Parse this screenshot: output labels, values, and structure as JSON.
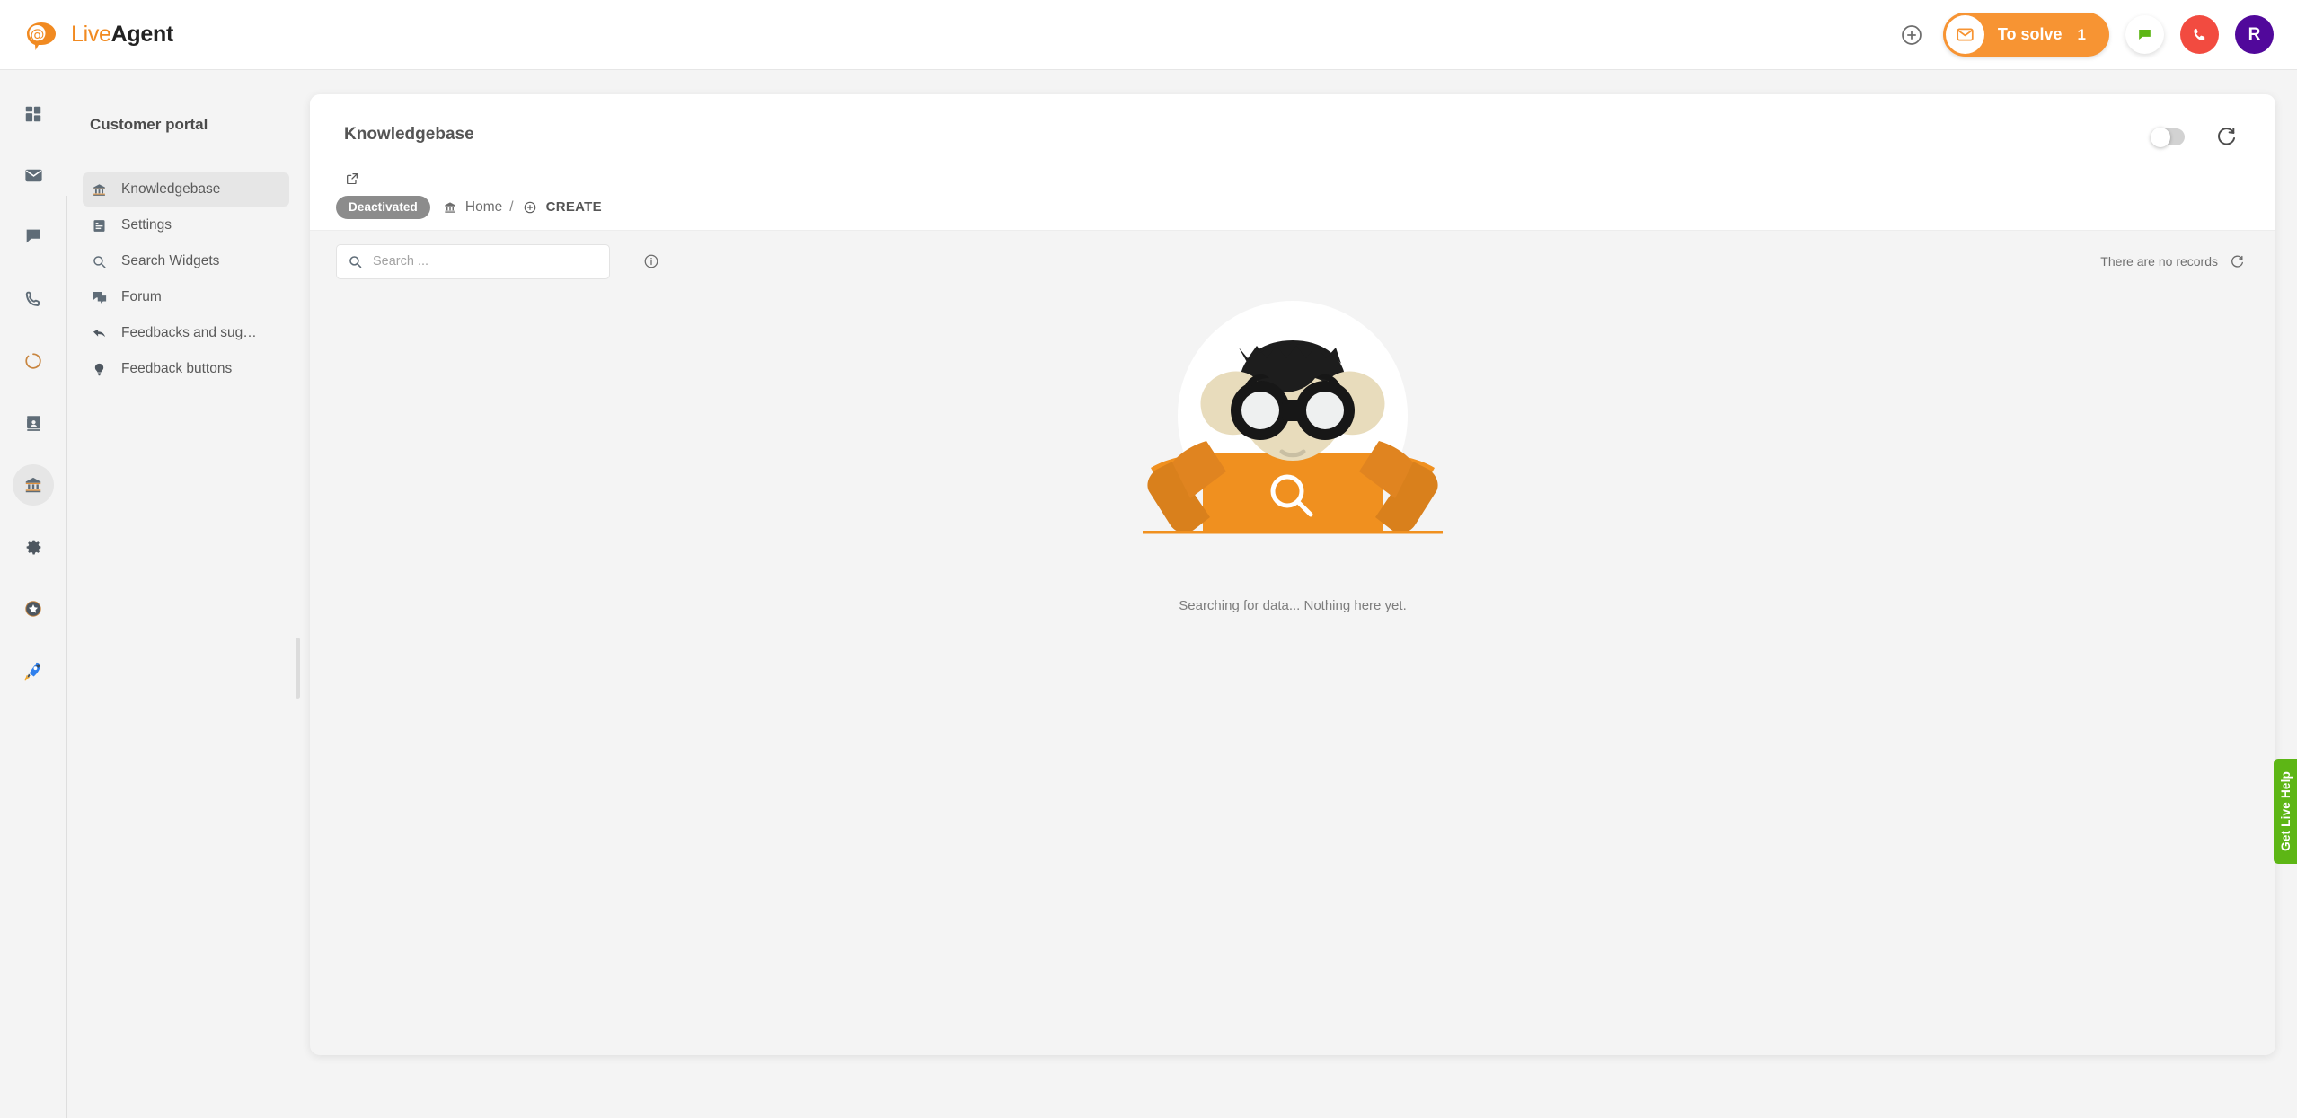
{
  "app": {
    "brand_live": "Live",
    "brand_agent": "Agent",
    "brand_logo_icon": "at-speech-bubble-logo"
  },
  "topbar": {
    "add_icon": "plus-circle-icon",
    "to_solve": {
      "icon": "envelope-icon",
      "label": "To solve",
      "count": "1"
    },
    "chat_icon": "chat-bubble-icon",
    "call_icon": "phone-icon",
    "avatar_initial": "R",
    "colors": {
      "accent_orange": "#f79433",
      "call_red": "#f24b40",
      "avatar_purple": "#51089b",
      "chat_green": "#5db615"
    }
  },
  "rail": {
    "items": [
      {
        "icon": "dashboard-grid-icon",
        "active": false
      },
      {
        "icon": "mail-icon",
        "active": false
      },
      {
        "icon": "chat-icon",
        "active": false
      },
      {
        "icon": "phone-icon",
        "active": false
      },
      {
        "icon": "circle-progress-icon",
        "active": false
      },
      {
        "icon": "contacts-card-icon",
        "active": false
      },
      {
        "icon": "knowledgebase-bank-icon",
        "active": true
      },
      {
        "icon": "gear-settings-icon",
        "active": false
      },
      {
        "icon": "star-badge-icon",
        "active": false
      },
      {
        "icon": "rocket-icon",
        "active": false
      }
    ]
  },
  "sidebar": {
    "title": "Customer portal",
    "items": [
      {
        "label": "Knowledgebase",
        "icon": "bank-icon",
        "active": true
      },
      {
        "label": "Settings",
        "icon": "list-settings-icon",
        "active": false
      },
      {
        "label": "Search Widgets",
        "icon": "search-icon",
        "active": false
      },
      {
        "label": "Forum",
        "icon": "forum-icon",
        "active": false
      },
      {
        "label": "Feedbacks and sug…",
        "icon": "reply-arrow-icon",
        "active": false
      },
      {
        "label": "Feedback buttons",
        "icon": "lightbulb-icon",
        "active": false
      }
    ]
  },
  "card": {
    "title": "Knowledgebase",
    "external_link_icon": "external-link-icon",
    "toggle": {
      "state": "off",
      "name": "activation-toggle"
    },
    "refresh_icon": "refresh-icon",
    "breadcrumb": {
      "status_badge": "Deactivated",
      "home_icon": "bank-icon",
      "home_label": "Home",
      "separator": "/",
      "create_icon": "plus-circle-icon",
      "create_label": "CREATE"
    },
    "toolbar": {
      "search_placeholder": "Search ...",
      "search_value": "",
      "search_icon": "search-icon",
      "info_icon": "info-circle-icon",
      "records_text": "There are no records",
      "records_refresh_icon": "refresh-icon"
    },
    "empty_state": {
      "caption": "Searching for data... Nothing here yet.",
      "illustration": "person-with-binoculars-searching"
    }
  },
  "live_help": {
    "label": "Get Live Help",
    "color": "#5db615"
  }
}
